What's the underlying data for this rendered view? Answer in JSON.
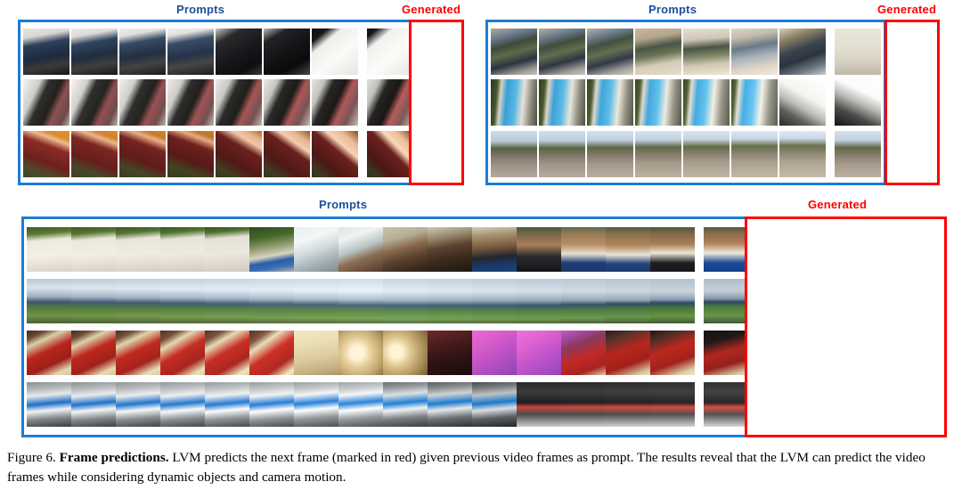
{
  "figure": {
    "caption_lead": "Figure 6.",
    "caption_bold": "Frame predictions.",
    "caption_rest": "LVM predicts the next frame (marked in red) given previous video frames as prompt. The results reveal that the LVM can predict the video frames while considering dynamic objects and camera motion."
  },
  "colors": {
    "prompts_label": "#1F4E9C",
    "generated_label": "#FF0000",
    "prompt_box_border": "#1C7CD6",
    "generated_box_border": "#FF0000",
    "background": "#FFFFFF"
  },
  "labels": {
    "prompts": "Prompts",
    "generated": "Generated"
  },
  "panels": [
    {
      "id": "top-left",
      "prompts_label": "Prompts",
      "generated_label": "Generated",
      "prompt_frame_count": 7,
      "generated_frame_count": 1,
      "rows": [
        {
          "id": "white-van-dashcam",
          "description": "white van front approaching camera, dashcam sequence"
        },
        {
          "id": "red-shirt-stairs",
          "description": "person in red shirt climbing dark staircase indoors"
        },
        {
          "id": "hand-on-red-carpet",
          "description": "hands and wooden plank on dark red carpet"
        }
      ]
    },
    {
      "id": "top-right",
      "prompts_label": "Prompts",
      "generated_label": "Generated",
      "prompt_frame_count": 7,
      "generated_frame_count": 1,
      "rows": [
        {
          "id": "indoor-person-bending",
          "description": "person in camo pants bending over indoors, camera pans to wall"
        },
        {
          "id": "blue-slide-jump",
          "description": "person jumping off blue slide into pool, ends in blur"
        },
        {
          "id": "street-crowd-purple",
          "description": "crowded street with person in purple jacket and lamppost"
        }
      ]
    },
    {
      "id": "bottom",
      "prompts_label": "Prompts",
      "generated_label": "Generated",
      "prompt_frame_count": 15,
      "generated_frame_count": 5,
      "rows": [
        {
          "id": "beach-wall-swimmer",
          "description": "shirtless man in blue shorts by white wall, then water splash, then backs of men"
        },
        {
          "id": "paraglider-field",
          "description": "orange paraglider over green fields under cloudy sky"
        },
        {
          "id": "red-jacket-woman",
          "description": "woman in red jacket with glasses, camera swings to light and magenta blur"
        },
        {
          "id": "blue-scooter",
          "description": "blue scooter handlebars, then scooter riding on dark road"
        }
      ]
    }
  ]
}
